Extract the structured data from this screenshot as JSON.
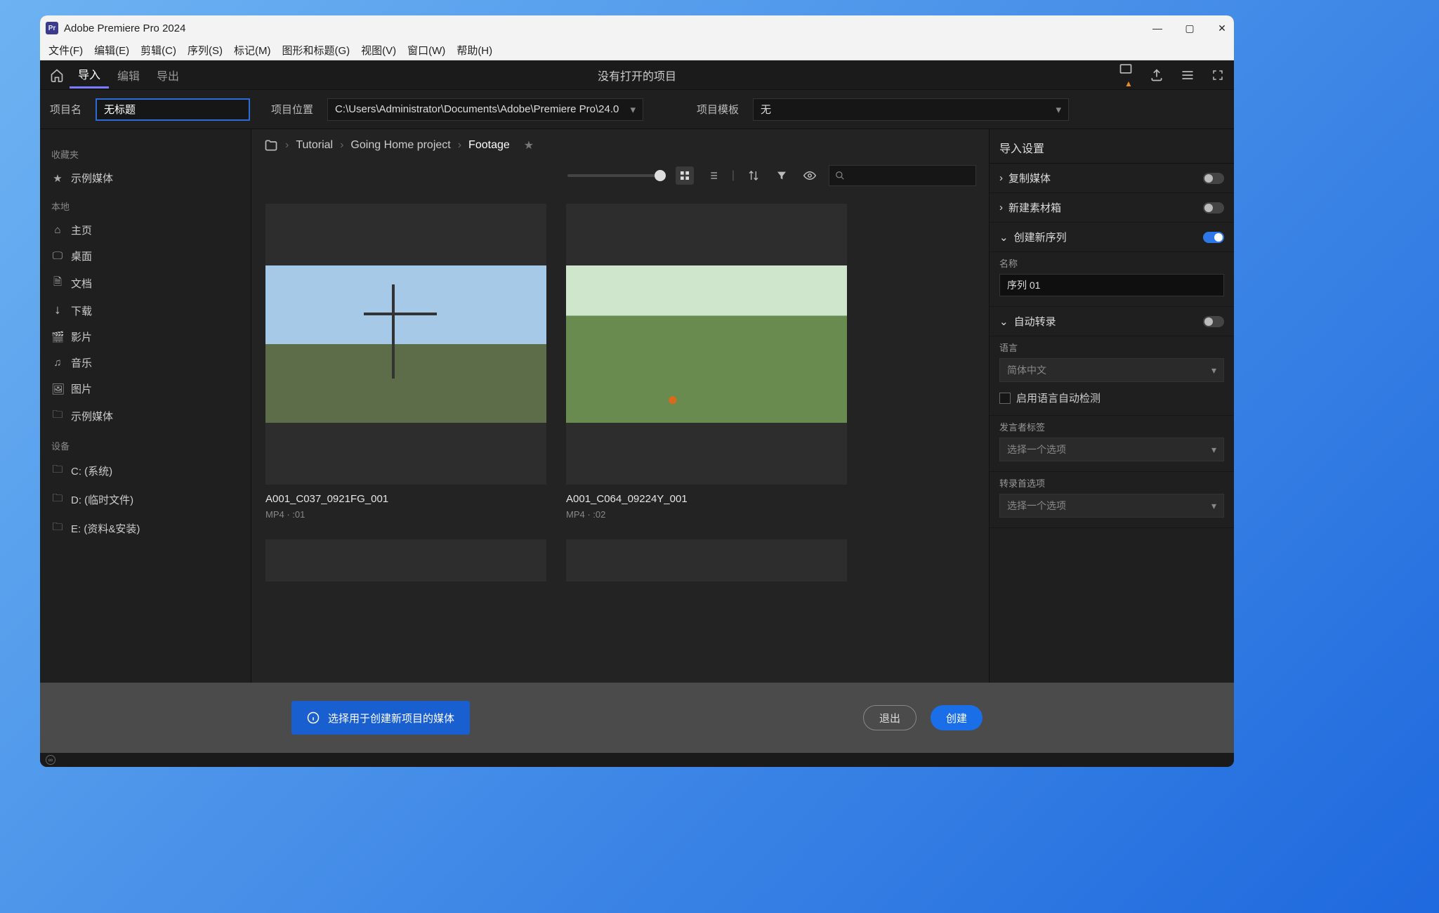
{
  "app": {
    "title": "Adobe Premiere Pro 2024",
    "logo_text": "Pr"
  },
  "menu": [
    "文件(F)",
    "编辑(E)",
    "剪辑(C)",
    "序列(S)",
    "标记(M)",
    "图形和标题(G)",
    "视图(V)",
    "窗口(W)",
    "帮助(H)"
  ],
  "toolbar": {
    "tabs": {
      "import": "导入",
      "edit": "编辑",
      "export": "导出"
    },
    "center": "没有打开的项目"
  },
  "project": {
    "name_label": "项目名",
    "name_value": "无标题",
    "path_label": "项目位置",
    "path_value": "C:\\Users\\Administrator\\Documents\\Adobe\\Premiere Pro\\24.0",
    "tpl_label": "项目模板",
    "tpl_value": "无"
  },
  "sidebar": {
    "fav_title": "收藏夹",
    "fav_items": [
      {
        "icon": "★",
        "label": "示例媒体"
      }
    ],
    "local_title": "本地",
    "local_items": [
      {
        "icon": "⌂",
        "label": "主页"
      },
      {
        "icon": "🖵",
        "label": "桌面"
      },
      {
        "icon": "🗎",
        "label": "文档"
      },
      {
        "icon": "⭣",
        "label": "下载"
      },
      {
        "icon": "🎬",
        "label": "影片"
      },
      {
        "icon": "♫",
        "label": "音乐"
      },
      {
        "icon": "🖼",
        "label": "图片"
      },
      {
        "icon": "🗀",
        "label": "示例媒体"
      }
    ],
    "device_title": "设备",
    "device_items": [
      {
        "icon": "🗀",
        "label": "C: (系统)"
      },
      {
        "icon": "🗀",
        "label": "D: (临时文件)"
      },
      {
        "icon": "🗀",
        "label": "E: (资料&安装)"
      }
    ]
  },
  "breadcrumb": [
    "Tutorial",
    "Going Home project",
    "Footage"
  ],
  "media": [
    {
      "title": "A001_C037_0921FG_001",
      "meta": "MP4 · :01"
    },
    {
      "title": "A001_C064_09224Y_001",
      "meta": "MP4 · :02"
    }
  ],
  "right": {
    "title": "导入设置",
    "copy_media": "复制媒体",
    "new_bin": "新建素材箱",
    "new_seq": "创建新序列",
    "name_label": "名称",
    "name_value": "序列 01",
    "auto_trans": "自动转录",
    "lang_label": "语言",
    "lang_value": "简体中文",
    "auto_detect": "启用语言自动检测",
    "speaker_label": "发言者标签",
    "speaker_value": "选择一个选项",
    "trans_pref_label": "转录首选项",
    "trans_pref_value": "选择一个选项"
  },
  "footer": {
    "info": "选择用于创建新项目的媒体",
    "exit": "退出",
    "create": "创建"
  }
}
